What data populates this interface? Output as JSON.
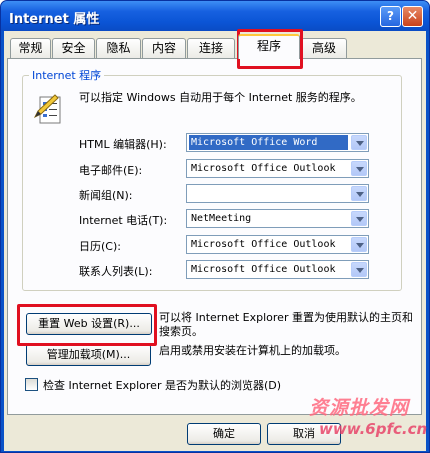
{
  "window": {
    "title": "Internet 属性",
    "help_glyph": "?",
    "close_glyph": "✕"
  },
  "tabs": [
    {
      "label": "常规"
    },
    {
      "label": "安全"
    },
    {
      "label": "隐私"
    },
    {
      "label": "内容"
    },
    {
      "label": "连接"
    },
    {
      "label": "程序",
      "active": true
    },
    {
      "label": "高级"
    }
  ],
  "programs": {
    "group_title": "Internet 程序",
    "description": "可以指定 Windows 自动用于每个 Internet 服务的程序。",
    "icon": "programs-list-icon",
    "rows": [
      {
        "label": "HTML 编辑器(H):",
        "value": "Microsoft Office Word",
        "selected": true
      },
      {
        "label": "电子邮件(E):",
        "value": "Microsoft Office Outlook"
      },
      {
        "label": "新闻组(N):",
        "value": ""
      },
      {
        "label": "Internet 电话(T):",
        "value": "NetMeeting"
      },
      {
        "label": "日历(C):",
        "value": "Microsoft Office Outlook"
      },
      {
        "label": "联系人列表(L):",
        "value": "Microsoft Office Outlook"
      }
    ]
  },
  "reset": {
    "button_label": "重置 Web 设置(R)...",
    "description": "可以将 Internet Explorer 重置为使用默认的主页和搜索页。"
  },
  "addons": {
    "button_label": "管理加载项(M)...",
    "description": "启用或禁用安装在计算机上的加载项。"
  },
  "default_browser_check": {
    "label": "检查 Internet Explorer 是否为默认的浏览器(D)",
    "checked": false
  },
  "footer": {
    "ok_label": "确定",
    "cancel_label": "取消"
  },
  "watermark": {
    "line1": "资源批发网",
    "line2": "www.6pfc.cn"
  },
  "colors": {
    "highlight": "#e01020",
    "title_bar": "#0b55d6",
    "group_title": "#0046d5"
  }
}
